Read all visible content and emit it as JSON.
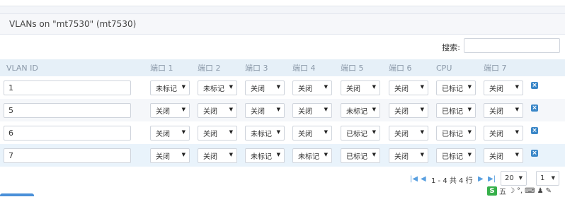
{
  "panel": {
    "title": "VLANs on \"mt7530\" (mt7530)"
  },
  "search": {
    "label": "搜索:",
    "value": ""
  },
  "table": {
    "headers": [
      "VLAN ID",
      "端口 1",
      "端口 2",
      "端口 3",
      "端口 4",
      "端口 5",
      "端口 6",
      "CPU",
      "端口 7"
    ],
    "rows": [
      {
        "vlan_id": "1",
        "ports": [
          "未标记",
          "未标记",
          "关闭",
          "关闭",
          "关闭",
          "关闭",
          "已标记",
          "关闭"
        ]
      },
      {
        "vlan_id": "5",
        "ports": [
          "关闭",
          "关闭",
          "关闭",
          "关闭",
          "未标记",
          "关闭",
          "已标记",
          "关闭"
        ]
      },
      {
        "vlan_id": "6",
        "ports": [
          "关闭",
          "关闭",
          "未标记",
          "关闭",
          "已标记",
          "关闭",
          "已标记",
          "关闭"
        ]
      },
      {
        "vlan_id": "7",
        "ports": [
          "关闭",
          "关闭",
          "未标记",
          "未标记",
          "已标记",
          "关闭",
          "已标记",
          "关闭"
        ]
      }
    ]
  },
  "pager": {
    "info": "1 - 4 共 4 行",
    "page_size": "20",
    "page": "1"
  },
  "icons": {
    "delete": "delete-icon",
    "dropdown": "dropdown-arrow-icon",
    "first": "first-page-icon",
    "prev": "prev-page-icon",
    "next": "next-page-icon",
    "last": "last-page-icon"
  },
  "tray": {
    "logo_letter": "S",
    "ime_char": "五"
  },
  "colors": {
    "header_bg": "#e6f0f8",
    "highlight_row": "#e9f3fb",
    "accent": "#3a87c8"
  }
}
